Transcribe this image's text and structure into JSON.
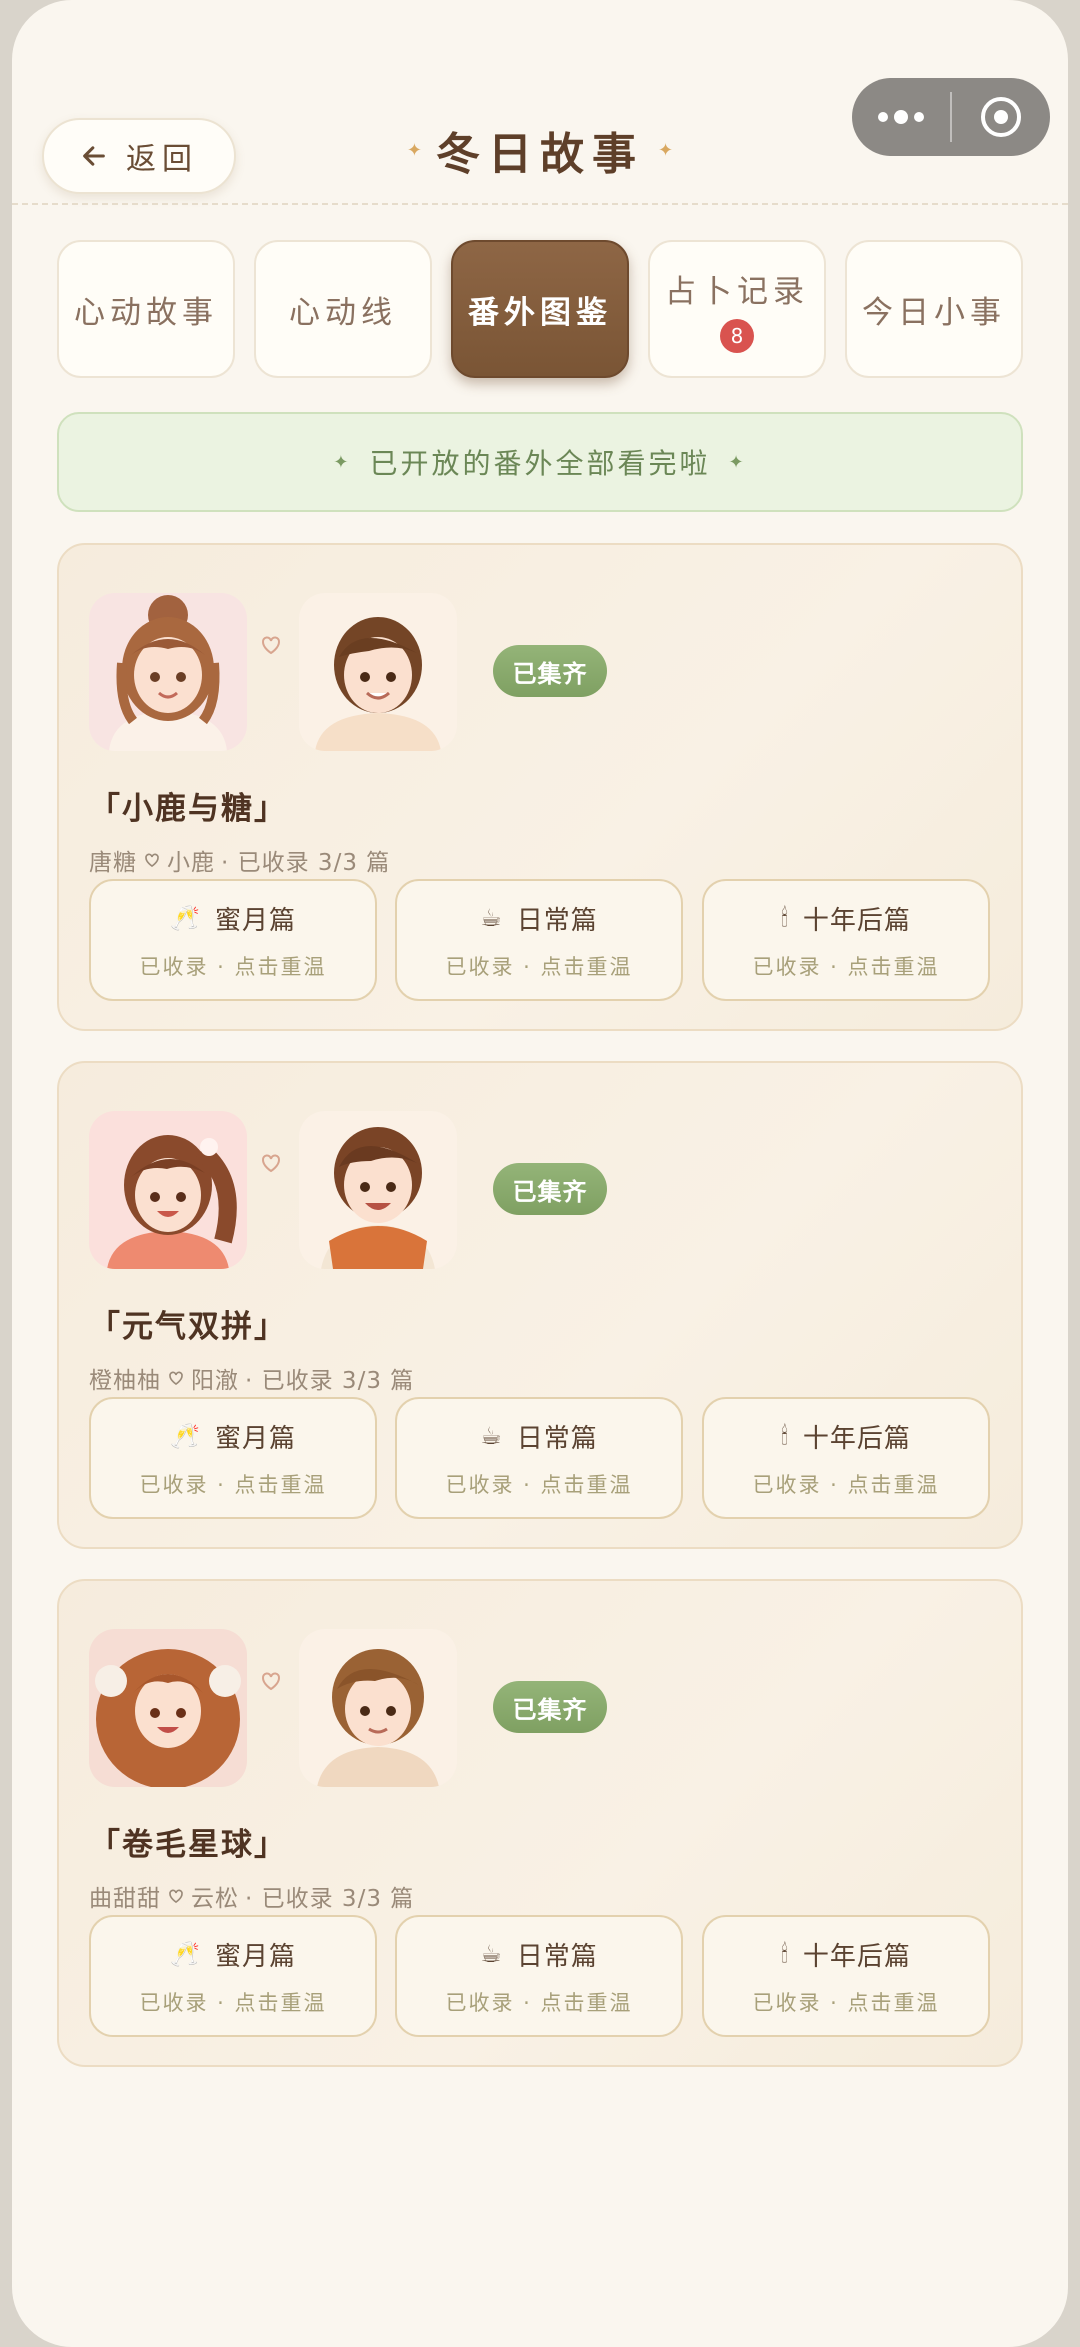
{
  "header": {
    "back_label": "返回",
    "title": "冬日故事"
  },
  "tabs": [
    {
      "label": "心动故事",
      "active": false
    },
    {
      "label": "心动线",
      "active": false
    },
    {
      "label": "番外图鉴",
      "active": true
    },
    {
      "label": "占卜记录",
      "active": false,
      "badge": "8"
    },
    {
      "label": "今日小事",
      "active": false
    }
  ],
  "notice": {
    "text": "已开放的番外全部看完啦"
  },
  "colors": {
    "accent_brown": "#7a5535",
    "status_green": "#7fa062",
    "badge_red": "#d9534f",
    "notice_bg": "#ebf3e1"
  },
  "cards": [
    {
      "status": "已集齐",
      "title": "「小鹿与糖」",
      "name_a": "唐糖",
      "name_b": "小鹿",
      "progress": "· 已收录 3/3 篇",
      "episodes": [
        {
          "icon": "🥂",
          "title": "蜜月篇",
          "sub": "已收录 · 点击重温"
        },
        {
          "icon": "☕",
          "title": "日常篇",
          "sub": "已收录 · 点击重温"
        },
        {
          "icon": "🕯",
          "title": "十年后篇",
          "sub": "已收录 · 点击重温"
        }
      ]
    },
    {
      "status": "已集齐",
      "title": "「元气双拼」",
      "name_a": "橙柚柚",
      "name_b": "阳澈",
      "progress": "· 已收录 3/3 篇",
      "episodes": [
        {
          "icon": "🥂",
          "title": "蜜月篇",
          "sub": "已收录 · 点击重温"
        },
        {
          "icon": "☕",
          "title": "日常篇",
          "sub": "已收录 · 点击重温"
        },
        {
          "icon": "🕯",
          "title": "十年后篇",
          "sub": "已收录 · 点击重温"
        }
      ]
    },
    {
      "status": "已集齐",
      "title": "「卷毛星球」",
      "name_a": "曲甜甜",
      "name_b": "云松",
      "progress": "· 已收录 3/3 篇",
      "episodes": [
        {
          "icon": "🥂",
          "title": "蜜月篇",
          "sub": "已收录 · 点击重温"
        },
        {
          "icon": "☕",
          "title": "日常篇",
          "sub": "已收录 · 点击重温"
        },
        {
          "icon": "🕯",
          "title": "十年后篇",
          "sub": "已收录 · 点击重温"
        }
      ]
    }
  ]
}
